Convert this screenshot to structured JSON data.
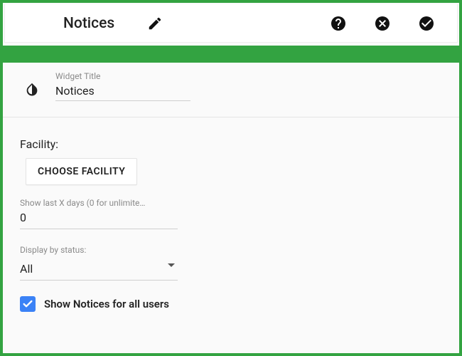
{
  "toolbar": {
    "title": "Notices"
  },
  "widget_title": {
    "label": "Widget Title",
    "value": "Notices"
  },
  "facility": {
    "label": "Facility:",
    "button": "CHOOSE FACILITY"
  },
  "days": {
    "label": "Show last X days (0 for unlimite…",
    "value": "0"
  },
  "status": {
    "label": "Display by status:",
    "value": "All"
  },
  "show_all_users": {
    "label": "Show Notices for all users",
    "checked": true
  },
  "colors": {
    "accent": "#33a341",
    "checkbox": "#3b82f6"
  }
}
